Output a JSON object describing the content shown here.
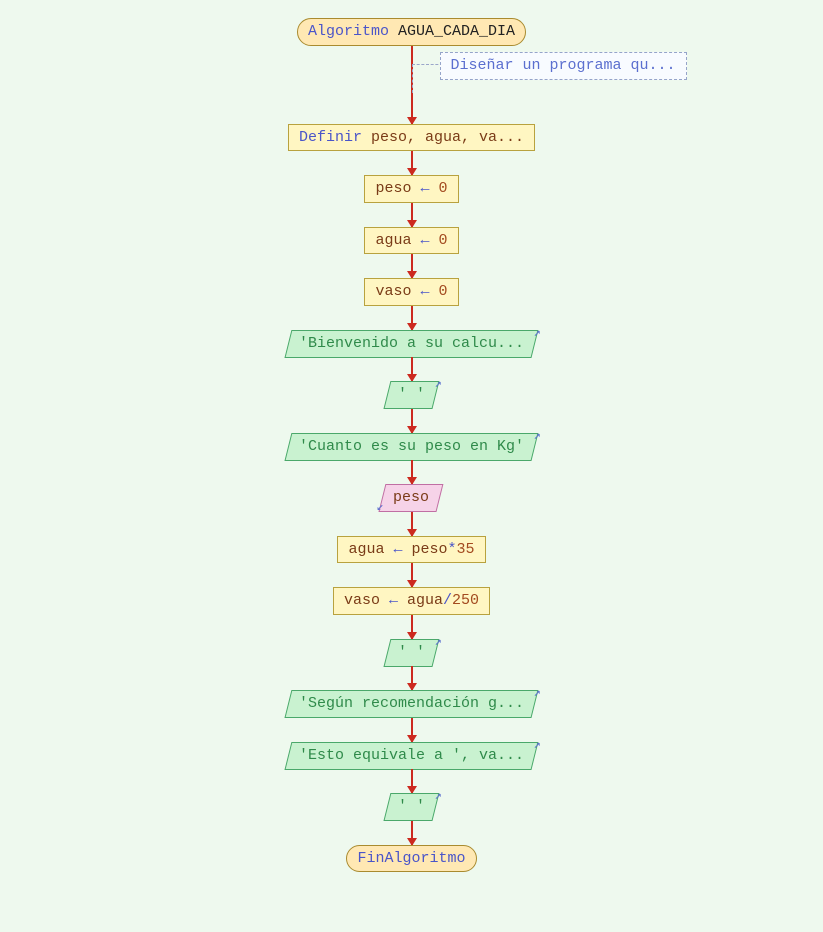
{
  "colors": {
    "background": "#eef9ee",
    "arrow": "#cc2a1f",
    "terminal_fill": "#ffe8b3",
    "terminal_border": "#a98b2f",
    "process_fill": "#fff6c2",
    "process_border": "#b8a23e",
    "io_fill": "#c9f2d0",
    "io_border": "#4aa86a",
    "input_fill": "#f6d3e8",
    "input_border": "#c06fa3",
    "comment_border": "#95a4c9",
    "keyword": "#4a55c9",
    "identifier": "#7a3b17",
    "number": "#a34a1f",
    "string": "#2f8a4a"
  },
  "terminal_start": {
    "keyword": "Algoritmo",
    "name": "AGUA_CADA_DIA"
  },
  "comment": "Diseñar un programa qu...",
  "declare": {
    "keyword": "Definir",
    "rest": " peso, agua, va..."
  },
  "assign1": {
    "var": "peso",
    "arrow": " ← ",
    "val": "0"
  },
  "assign2": {
    "var": "agua",
    "arrow": " ← ",
    "val": "0"
  },
  "assign3": {
    "var": "vaso",
    "arrow": " ← ",
    "val": "0"
  },
  "out1": "'Bienvenido a su calcu...",
  "out_blank": "' '",
  "out2": "'Cuanto es su peso en Kg'",
  "input1": "peso",
  "assign4": {
    "var": "agua",
    "arrow": " ← ",
    "expr_var": "peso",
    "op": "*",
    "num": "35"
  },
  "assign5": {
    "var": "vaso",
    "arrow": " ← ",
    "expr_var": "agua",
    "op": "/",
    "num": "250"
  },
  "out3": "'Según recomendación g...",
  "out4": "'Esto equivale a ', va...",
  "terminal_end": "FinAlgoritmo"
}
